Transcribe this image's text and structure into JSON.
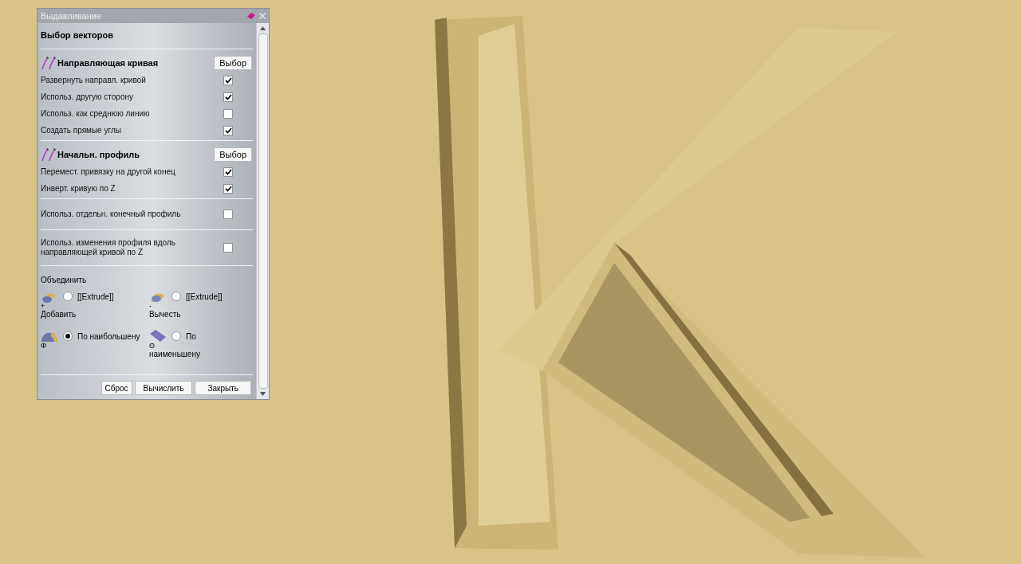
{
  "panel": {
    "title": "Выдавливание",
    "section_title": "Выбор векторов",
    "sections": [
      {
        "header": "Направляющая кривая",
        "button": "Выбор",
        "options": [
          {
            "label": "Развернуть направл. кривой",
            "checked": true
          },
          {
            "label": "Использ. другую сторону",
            "checked": true
          },
          {
            "label": "Использ. как среднюю линию",
            "checked": false
          },
          {
            "label": "Создать прямые углы",
            "checked": true
          }
        ]
      },
      {
        "header": "Начальн. профиль",
        "button": "Выбор",
        "options": [
          {
            "label": "Перемест. привязку на другой конец",
            "checked": true
          },
          {
            "label": "Инверт. кривую по Z",
            "checked": true
          }
        ]
      },
      {
        "options": [
          {
            "label": "Использ. отдельн. конечный профиль",
            "checked": false
          }
        ]
      },
      {
        "options": [
          {
            "label": "Использ. изменения профиля вдоль направляющей кривой по Z",
            "checked": false
          }
        ]
      }
    ],
    "combine": {
      "label": "Объединить",
      "choices": [
        {
          "kind": "add",
          "sign": "+",
          "label": "[[Extrude]]",
          "caption": "Добавить",
          "selected": false
        },
        {
          "kind": "subtract",
          "sign": "-",
          "label": "[[Extrude]]",
          "caption": "Вычесть",
          "selected": false
        },
        {
          "kind": "merge",
          "sign": "Φ",
          "label": "По наибольшену",
          "selected": true
        },
        {
          "kind": "flat",
          "sign": "Θ",
          "label": "По",
          "caption": "наименьшену",
          "selected": false
        }
      ]
    },
    "buttons": [
      "Сброс",
      "Вычислить",
      "Закрыть"
    ]
  }
}
